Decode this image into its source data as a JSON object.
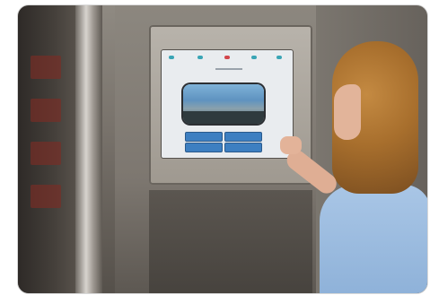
{
  "scene": {
    "subject": "woman-touching-kiosk-screen",
    "colors": {
      "hair": "#a86f2d",
      "shirt": "#9fbfe2",
      "screen_button": "#3d7fc1",
      "kiosk": "#8c877f"
    },
    "screen": {
      "button_count": 4,
      "icon_colors": [
        "#3aa5b5",
        "#3aa5b5",
        "#d2464b",
        "#3aa5b5",
        "#3aa5b5"
      ]
    }
  }
}
